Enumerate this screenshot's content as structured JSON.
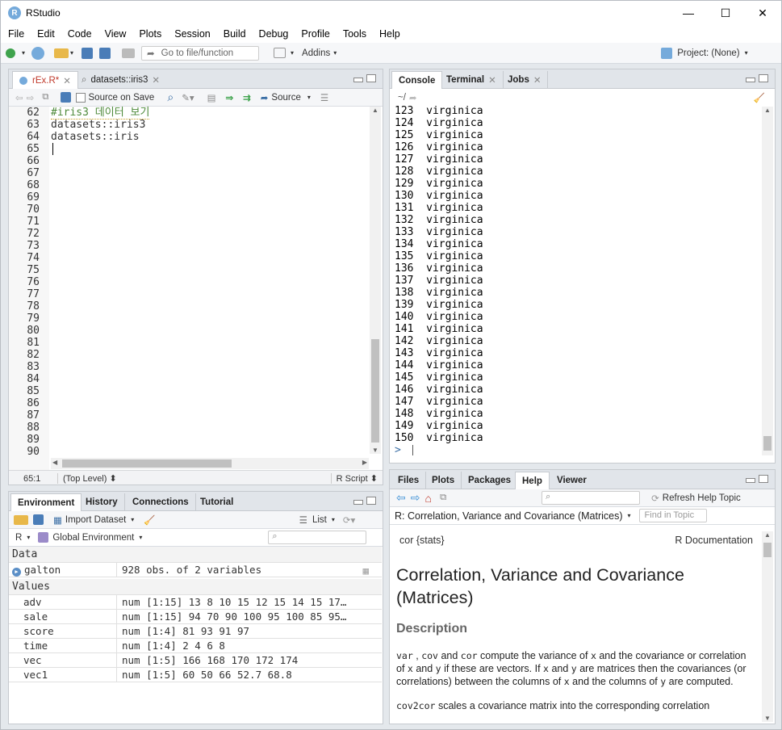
{
  "window": {
    "title": "RStudio",
    "minimize": "—",
    "maximize": "☐",
    "close": "✕"
  },
  "menu": [
    "File",
    "Edit",
    "Code",
    "View",
    "Plots",
    "Session",
    "Build",
    "Debug",
    "Profile",
    "Tools",
    "Help"
  ],
  "toolbar": {
    "goto_placeholder": "Go to file/function",
    "addins": "Addins",
    "project": "Project: (None)"
  },
  "editor": {
    "tabs": [
      {
        "label": "rEx.R*"
      },
      {
        "label": "datasets::iris3"
      }
    ],
    "source_on_save": "Source on Save",
    "source_button": "Source",
    "line_numbers": [
      "62",
      "63",
      "64",
      "65",
      "66",
      "67",
      "68",
      "69",
      "70",
      "71",
      "72",
      "73",
      "74",
      "75",
      "76",
      "77",
      "78",
      "79",
      "80",
      "81",
      "82",
      "83",
      "84",
      "85",
      "86",
      "87",
      "88",
      "89",
      "90"
    ],
    "lines": [
      "#iris3 데이터 보기",
      "datasets::iris3",
      "datasets::iris"
    ],
    "status_pos": "65:1",
    "status_scope": "(Top Level) ⬍",
    "status_type": "R Script ⬍"
  },
  "console": {
    "tabs": [
      "Console",
      "Terminal",
      "Jobs"
    ],
    "path": "~/",
    "rows": [
      [
        "123",
        "virginica"
      ],
      [
        "124",
        "virginica"
      ],
      [
        "125",
        "virginica"
      ],
      [
        "126",
        "virginica"
      ],
      [
        "127",
        "virginica"
      ],
      [
        "128",
        "virginica"
      ],
      [
        "129",
        "virginica"
      ],
      [
        "130",
        "virginica"
      ],
      [
        "131",
        "virginica"
      ],
      [
        "132",
        "virginica"
      ],
      [
        "133",
        "virginica"
      ],
      [
        "134",
        "virginica"
      ],
      [
        "135",
        "virginica"
      ],
      [
        "136",
        "virginica"
      ],
      [
        "137",
        "virginica"
      ],
      [
        "138",
        "virginica"
      ],
      [
        "139",
        "virginica"
      ],
      [
        "140",
        "virginica"
      ],
      [
        "141",
        "virginica"
      ],
      [
        "142",
        "virginica"
      ],
      [
        "143",
        "virginica"
      ],
      [
        "144",
        "virginica"
      ],
      [
        "145",
        "virginica"
      ],
      [
        "146",
        "virginica"
      ],
      [
        "147",
        "virginica"
      ],
      [
        "148",
        "virginica"
      ],
      [
        "149",
        "virginica"
      ],
      [
        "150",
        "virginica"
      ]
    ],
    "prompt": ">"
  },
  "env": {
    "tabs": [
      "Environment",
      "History",
      "Connections",
      "Tutorial"
    ],
    "import_label": "Import Dataset",
    "list_label": "List",
    "lang": "R",
    "scope": "Global Environment",
    "data_header": "Data",
    "values_header": "Values",
    "data": [
      {
        "name": "galton",
        "value": "928 obs. of 2 variables"
      }
    ],
    "values": [
      {
        "name": "adv",
        "value": "num [1:15] 13 8 10 15 12 15 14 15 17…"
      },
      {
        "name": "sale",
        "value": "num [1:15] 94 70 90 100 95 100 85 95…"
      },
      {
        "name": "score",
        "value": "num [1:4] 81 93 91 97"
      },
      {
        "name": "time",
        "value": "num [1:4] 2 4 6 8"
      },
      {
        "name": "vec",
        "value": "num [1:5] 166 168 170 172 174"
      },
      {
        "name": "vec1",
        "value": "num [1:5] 60 50 66 52.7 68.8"
      }
    ]
  },
  "help": {
    "tabs": [
      "Files",
      "Plots",
      "Packages",
      "Help",
      "Viewer"
    ],
    "refresh": "Refresh Help Topic",
    "topic": "R: Correlation, Variance and Covariance (Matrices)",
    "find_placeholder": "Find in Topic",
    "pkg": "cor {stats}",
    "rdoc": "R Documentation",
    "heading": "Correlation, Variance and Covariance (Matrices)",
    "desc_heading": "Description",
    "p1_parts": [
      "var",
      " , ",
      "cov",
      " and ",
      "cor",
      " compute the variance of ",
      "x",
      " and the covariance or correlation of ",
      "x",
      " and ",
      "y",
      " if these are vectors. If ",
      "x",
      " and ",
      "y",
      " are matrices then the covariances (or correlations) between the columns of ",
      "x",
      " and the columns of ",
      "y",
      " are computed."
    ],
    "p2_code": "cov2cor",
    "p2_text": " scales a covariance matrix into the corresponding correlation"
  },
  "colors": {
    "accent": "#75aadb",
    "home": "#c0392b"
  }
}
